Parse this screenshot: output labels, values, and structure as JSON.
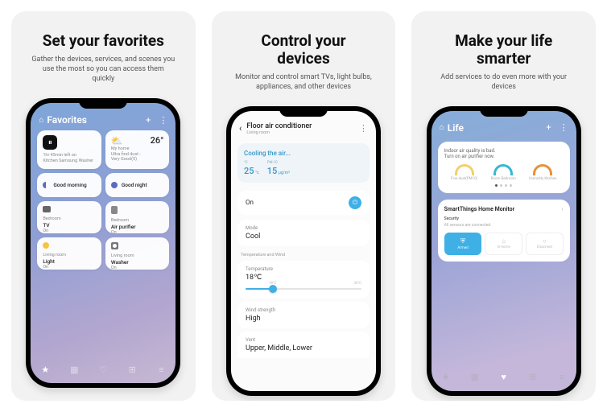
{
  "panels": [
    {
      "title": "Set your favorites",
      "sub": "Gather the devices, services, and scenes you use the most so you can access them quickly"
    },
    {
      "title": "Control your devices",
      "sub": "Monitor and control smart TVs, light bulbs, appliances, and other devices"
    },
    {
      "title": "Make your life smarter",
      "sub": "Add services to do even more with your devices"
    }
  ],
  "favorites": {
    "header": "Favorites",
    "washer": {
      "status": "1hr 45min left on",
      "name": "Kitchen Samsung Washer"
    },
    "weather": {
      "temp": "26°",
      "place": "My home",
      "detail": "Ultra find dust : Very Good(5)"
    },
    "scenes": {
      "morning": "Good morning",
      "night": "Good night"
    },
    "devices": {
      "tv": {
        "room": "Bedroom",
        "name": "TV",
        "state": "On"
      },
      "purifier": {
        "room": "Bedroom",
        "name": "Air purifier",
        "state": "On"
      },
      "light": {
        "room": "Living room",
        "name": "Light",
        "state": "On"
      },
      "washer2": {
        "room": "Living room",
        "name": "Washer",
        "state": "On"
      }
    }
  },
  "control": {
    "title": "Floor air conditioner",
    "subtitle": "Living room",
    "status": "Cooling the air...",
    "readings": {
      "temp_cap": "°C",
      "temp": "25",
      "temp_unit": "°c",
      "pm_cap": "PM 10",
      "pm": "15",
      "pm_unit": "μg/m³"
    },
    "power": "On",
    "mode_label": "Mode",
    "mode": "Cool",
    "section": "Temperature and Wind",
    "temp_label": "Temperature",
    "temp_value": "18℃",
    "temp_min": "18°C",
    "temp_max": "30°C",
    "wind_label": "Wind strength",
    "wind_value": "High",
    "vent_label": "Vent",
    "vent_value": "Upper, Middle, Lower"
  },
  "life": {
    "header": "Life",
    "aq_msg1": "Indoor air quality is bad.",
    "aq_msg2": "Turn on air purifier now.",
    "gauges": [
      "Fine dust(PM10)",
      "Room Bedroom",
      "Humidity Kitchen"
    ],
    "hm_title": "SmartThings Home Monitor",
    "hm_sub_t": "Security",
    "hm_sub_d": "All sensors are connected.",
    "btns": [
      "Armed",
      "In-home",
      "Disarmed"
    ]
  }
}
